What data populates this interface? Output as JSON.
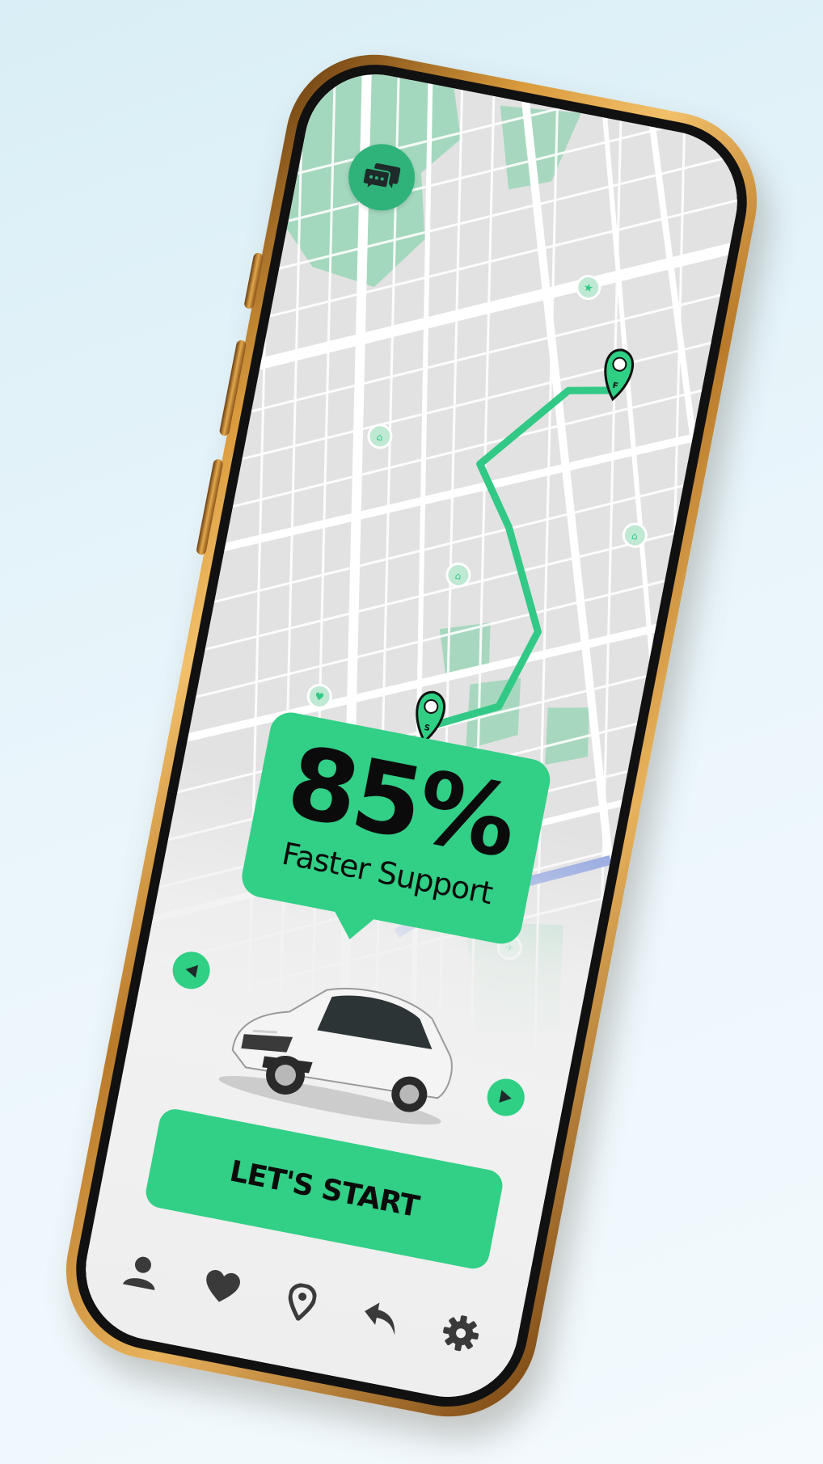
{
  "map": {
    "chat_icon": "chat-bubbles-icon",
    "route": {
      "start_label": "S",
      "finish_label": "F",
      "route_color": "#31c985"
    },
    "poi_icons": [
      "star-pin-icon",
      "hotel-pin-icon",
      "hotel-pin-icon",
      "hotel-pin-icon",
      "heart-pin-icon",
      "star-pin-icon",
      "plane-pin-icon"
    ]
  },
  "stat_bubble": {
    "value": "85%",
    "caption": "Faster Support",
    "color": "#32cf86"
  },
  "car_carousel": {
    "prev_icon": "triangle-left-icon",
    "next_icon": "triangle-right-icon",
    "car_image": "white-hatchback-car"
  },
  "cta": {
    "label": "LET'S START",
    "color": "#32cf86"
  },
  "bottom_nav": [
    {
      "icon": "user-icon"
    },
    {
      "icon": "heart-icon"
    },
    {
      "icon": "location-pin-icon"
    },
    {
      "icon": "back-arrow-icon"
    },
    {
      "icon": "gear-icon"
    }
  ],
  "frame": {
    "accent_color": "#d99a3c"
  }
}
